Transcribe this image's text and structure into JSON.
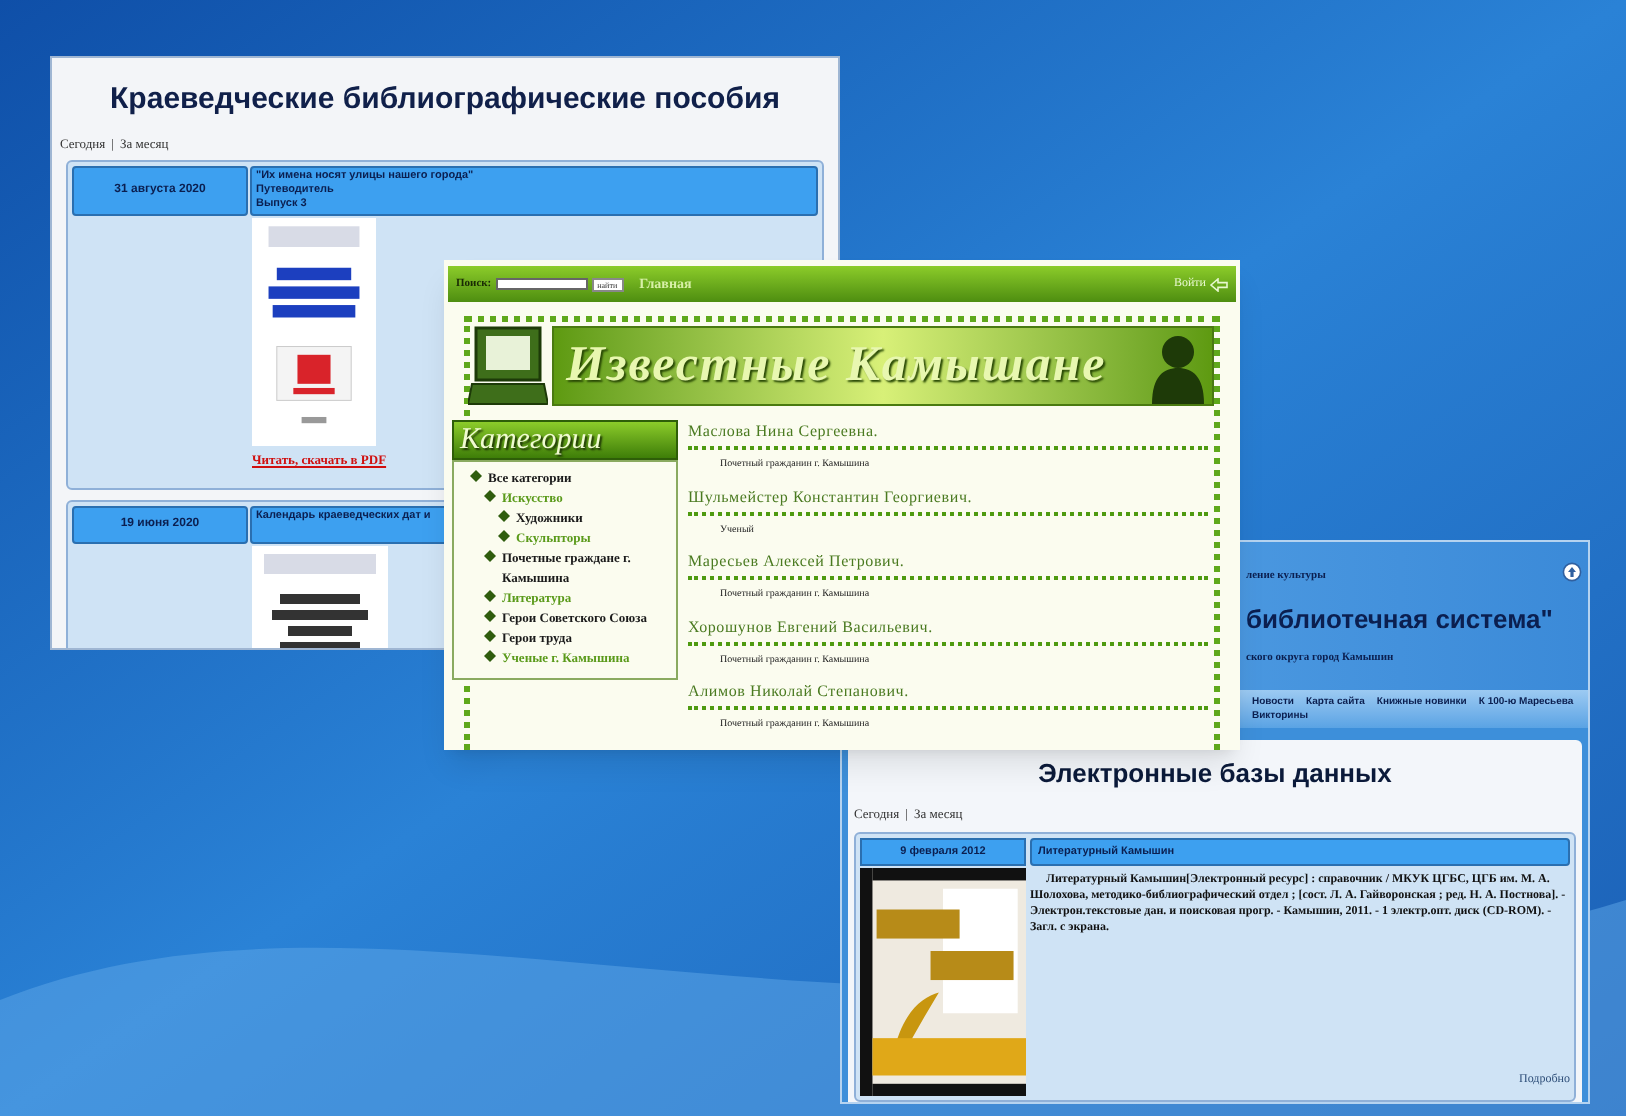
{
  "bibliography_page": {
    "title": "Краеведческие библиографические пособия",
    "filter_links": [
      "Сегодня",
      "За месяц"
    ],
    "separator": "|",
    "entries": [
      {
        "date": "31 августа 2020",
        "title_lines": [
          "\"Их имена носят улицы нашего города\"",
          "Путеводитель",
          "Выпуск 3"
        ],
        "link": "Читать, скачать в PDF"
      },
      {
        "date": "19 июня 2020",
        "title_lines": [
          "Календарь краеведческих дат и"
        ]
      }
    ]
  },
  "famous_people_page": {
    "search_label": "Поиск:",
    "search_button": "найти",
    "nav_link": "Главная",
    "login": "Войти",
    "banner_title": "Известные Камышане",
    "categories_title": "Категории",
    "categories": [
      {
        "label": "Все категории",
        "color": "#1a1a1a",
        "children": [
          {
            "label": "Искусство",
            "color": "#5a9a1a",
            "children": [
              {
                "label": "Художники",
                "color": "#1a1a1a"
              },
              {
                "label": "Скульпторы",
                "color": "#5a9a1a"
              }
            ]
          },
          {
            "label": "Почетные граждане г. Камышина",
            "color": "#1a1a1a"
          },
          {
            "label": "Литература",
            "color": "#5a9a1a"
          },
          {
            "label": "Герои Советского Союза",
            "color": "#1a1a1a"
          },
          {
            "label": "Герои труда",
            "color": "#1a1a1a"
          },
          {
            "label": "Ученые г. Камышина",
            "color": "#5a9a1a"
          }
        ]
      }
    ],
    "people": [
      {
        "name": "Маслова Нина Сергеевна.",
        "note": "Почетный гражданин г. Камышина"
      },
      {
        "name": "Шульмейстер Константин Георгиевич.",
        "note": "Ученый"
      },
      {
        "name": "Маресьев Алексей Петрович.",
        "note": "Почетный гражданин г. Камышина"
      },
      {
        "name": "Хорошунов Евгений Васильевич.",
        "note": "Почетный гражданин г. Камышина"
      },
      {
        "name": "Алимов Николай Степанович.",
        "note": "Почетный гражданин г. Камышина"
      }
    ]
  },
  "library_page": {
    "org_line": "ление культуры",
    "system_name": "библиотечная система\"",
    "district_line": "ского округа город Камышин",
    "nav": [
      "Новости",
      "Карта сайта",
      "Книжные новинки",
      "К 100-ю Маресьева",
      "Викторины"
    ],
    "title": "Электронные базы данных",
    "filter_links": [
      "Сегодня",
      "За месяц"
    ],
    "separator": "|",
    "entries": [
      {
        "date": "9 февраля 2012",
        "title": "Литературный Камышин",
        "description": "Литературный Камышин[Электронный ресурс] : справочник / МКУК ЦГБС, ЦГБ им. М. А. Шолохова, методико-библиографический отдел ; [сост. Л. А. Гайворонская ; ред. Н. А. Постнова]. - Электрон.текстовые дан. и поисковая прогр. - Камышин, 2011. - 1 электр.опт. диск (CD-ROM). - Загл. с экрана.",
        "more_link": "Подробно"
      }
    ]
  }
}
